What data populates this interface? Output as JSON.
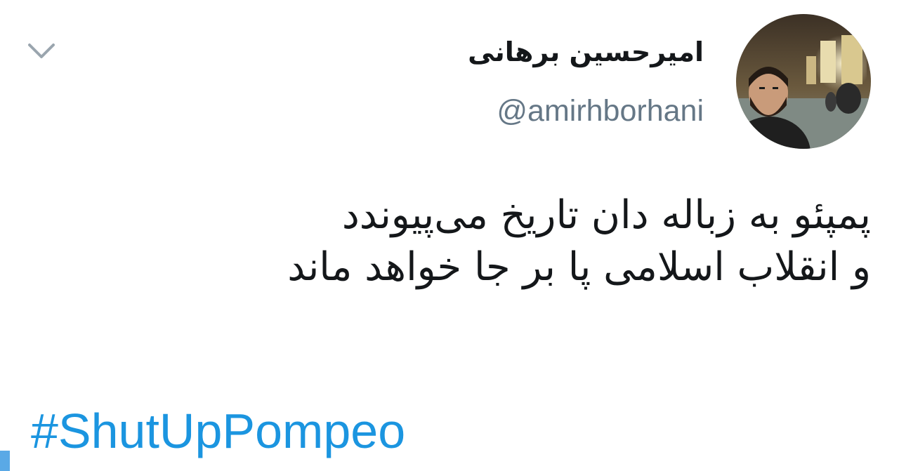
{
  "tweet": {
    "author": {
      "display_name": "امیرحسین برهانی",
      "handle": "@amirhborhani",
      "avatar_icon": "profile-photo"
    },
    "text_lines": [
      "پمپئو به زباله دان تاریخ می‌پیوندد",
      "و انقلاب اسلامی پا بر جا خواهد ماند"
    ],
    "hashtag": "#ShutUpPompeo",
    "menu_icon": "chevron-down-icon"
  },
  "colors": {
    "text": "#14171a",
    "secondary": "#657786",
    "link": "#1b95e0",
    "background": "#ffffff"
  }
}
